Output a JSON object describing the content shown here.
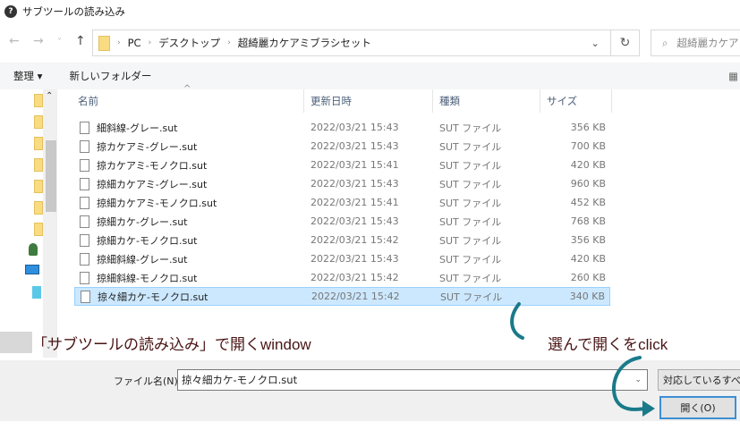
{
  "window": {
    "title": "サブツールの読み込み",
    "logo": "clip-studio-logo"
  },
  "nav": {
    "back": "←",
    "forward": "→",
    "recent": "˅",
    "up": "↑"
  },
  "address": {
    "crumbs": [
      "PC",
      "デスクトップ",
      "超綺麗カケアミブラシセット"
    ],
    "dropdown": "⌄",
    "refresh": "↻"
  },
  "search": {
    "icon": "⌕",
    "placeholder": "超綺麗カケアミブラシセット"
  },
  "toolbar": {
    "organize": "整理 ▾",
    "new_folder": "新しいフォルダー",
    "view_icon": "▦"
  },
  "columns": {
    "name": "名前",
    "date": "更新日時",
    "type": "種類",
    "size": "サイズ",
    "sort_indicator": "^"
  },
  "files": [
    {
      "name": "細斜線-グレー.sut",
      "date": "2022/03/21 15:43",
      "type": "SUT ファイル",
      "size": "356 KB"
    },
    {
      "name": "掠カケアミ-グレー.sut",
      "date": "2022/03/21 15:43",
      "type": "SUT ファイル",
      "size": "700 KB"
    },
    {
      "name": "掠カケアミ-モノクロ.sut",
      "date": "2022/03/21 15:41",
      "type": "SUT ファイル",
      "size": "420 KB"
    },
    {
      "name": "掠細カケアミ-グレー.sut",
      "date": "2022/03/21 15:43",
      "type": "SUT ファイル",
      "size": "960 KB"
    },
    {
      "name": "掠細カケアミ-モノクロ.sut",
      "date": "2022/03/21 15:41",
      "type": "SUT ファイル",
      "size": "452 KB"
    },
    {
      "name": "掠細カケ-グレー.sut",
      "date": "2022/03/21 15:43",
      "type": "SUT ファイル",
      "size": "768 KB"
    },
    {
      "name": "掠細カケ-モノクロ.sut",
      "date": "2022/03/21 15:42",
      "type": "SUT ファイル",
      "size": "356 KB"
    },
    {
      "name": "掠細斜線-グレー.sut",
      "date": "2022/03/21 15:43",
      "type": "SUT ファイル",
      "size": "420 KB"
    },
    {
      "name": "掠細斜線-モノクロ.sut",
      "date": "2022/03/21 15:42",
      "type": "SUT ファイル",
      "size": "260 KB"
    },
    {
      "name": "掠々細カケ-モノクロ.sut",
      "date": "2022/03/21 15:42",
      "type": "SUT ファイル",
      "size": "340 KB",
      "selected": true
    }
  ],
  "annotations": {
    "left": "「サブツールの読み込み」で開くwindow",
    "right": "選んで開くをclick",
    "arrow_color": "#1a7a8a"
  },
  "footer": {
    "filename_label": "ファイル名(N):",
    "filename_value": "掠々細カケ-モノクロ.sut",
    "filetype": "対応しているすべてのファイル",
    "open": "開く(O)"
  }
}
